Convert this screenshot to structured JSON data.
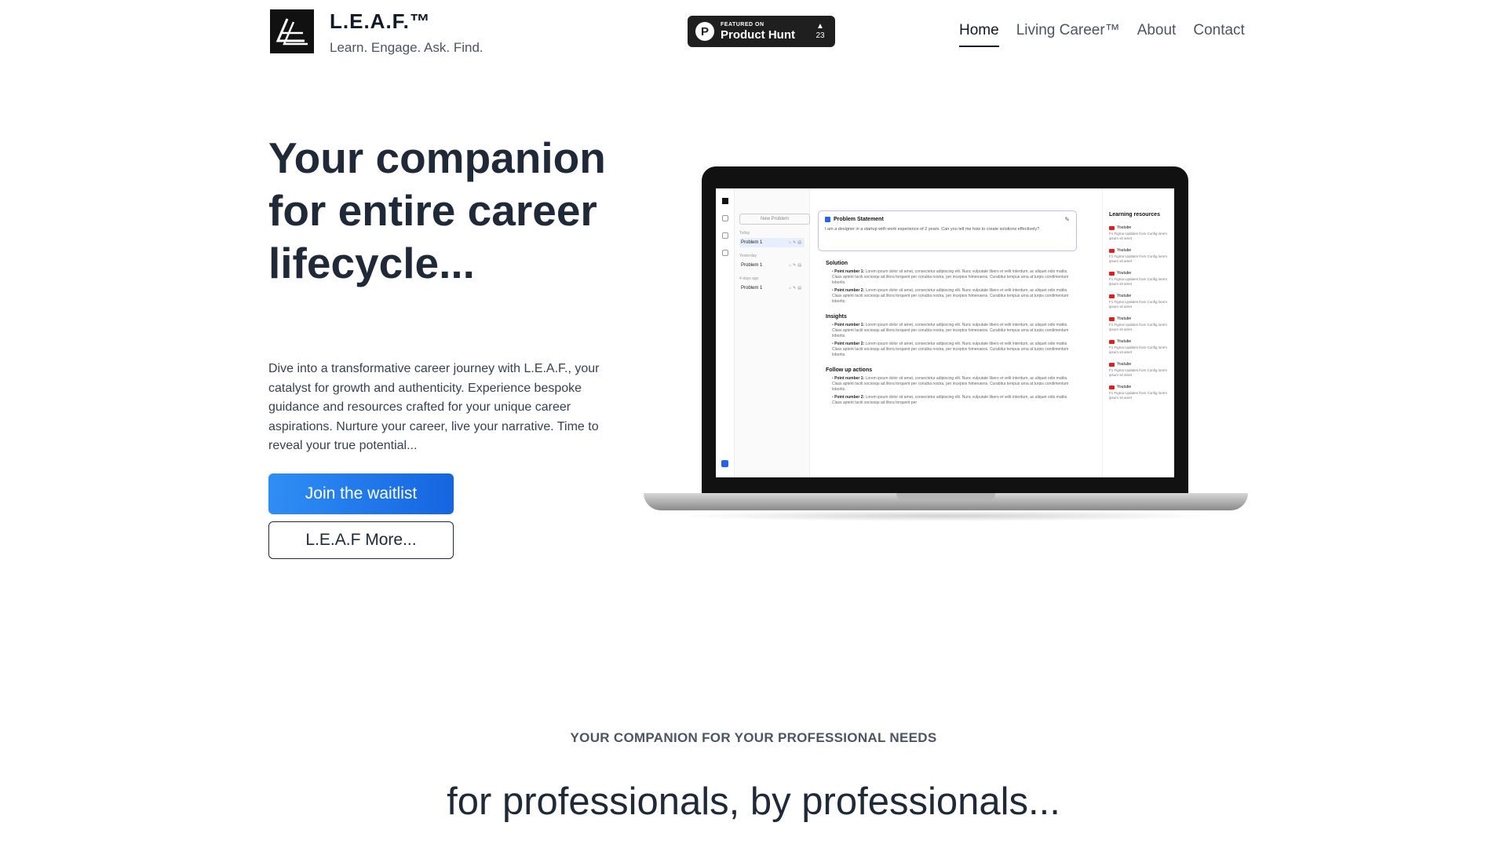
{
  "header": {
    "brand_name": "L.E.A.F.™",
    "brand_tagline": "Learn. Engage. Ask. Find.",
    "product_hunt": {
      "small": "FEATURED ON",
      "big": "Product Hunt",
      "votes": "23",
      "arrow": "▲",
      "logo_letter": "P"
    },
    "nav": [
      {
        "label": "Home",
        "active": true
      },
      {
        "label": "Living Career™",
        "active": false
      },
      {
        "label": "About",
        "active": false
      },
      {
        "label": "Contact",
        "active": false
      }
    ]
  },
  "hero": {
    "title": "Your companion for entire career lifecycle...",
    "description": "Dive into a transformative career journey with L.E.A.F., your catalyst for growth and authenticity. Experience bespoke guidance and resources crafted for your unique career aspirations. Nurture your career, live your narrative. Time to reveal your true potential...",
    "primary_button": "Join the waitlist",
    "secondary_button": "L.E.A.F More..."
  },
  "mockup": {
    "new_problem": "New Problem",
    "groups": [
      {
        "label": "Today",
        "items": [
          "Problem 1"
        ]
      },
      {
        "label": "Yesterday",
        "items": [
          "Problem 1"
        ]
      },
      {
        "label": "4 days ago",
        "items": [
          "Problem 1"
        ]
      }
    ],
    "problem_statement_title": "Problem Statement",
    "problem_statement_text": "I am a designer in a startup with work experience of 2 years. Can you tell me how to create solutions effectively?",
    "sections": [
      {
        "title": "Solution",
        "points": [
          {
            "label": "Point number 1:",
            "text": "Lorem ipsum dolor sit amet, consectetur adipiscing elit. Nunc vulputate libero et velit interdum, ac aliquet odio mattis. Class aptent taciti sociosqu ad litora torquent per conubia nostra, per inceptos himenaeos. Curabitur tempus urna at turpis condimentum lobortis."
          },
          {
            "label": "Point number 2:",
            "text": "Lorem ipsum dolor sit amet, consectetur adipiscing elit. Nunc vulputate libero et velit interdum, ac aliquet odio mattis. Class aptent taciti sociosqu ad litora torquent per conubia nostra, per inceptos himenaeos. Curabitur tempus urna at turpis condimentum lobortis."
          }
        ]
      },
      {
        "title": "Insights",
        "points": [
          {
            "label": "Point number 1:",
            "text": "Lorem ipsum dolor sit amet, consectetur adipiscing elit. Nunc vulputate libero et velit interdum, ac aliquet odio mattis. Class aptent taciti sociosqu ad litora torquent per conubia nostra, per inceptos himenaeos. Curabitur tempus urna at turpis condimentum lobortis."
          },
          {
            "label": "Point number 2:",
            "text": "Lorem ipsum dolor sit amet, consectetur adipiscing elit. Nunc vulputate libero et velit interdum, ac aliquet odio mattis. Class aptent taciti sociosqu ad litora torquent per conubia nostra, per inceptos himenaeos. Curabitur tempus urna at turpis condimentum lobortis."
          }
        ]
      },
      {
        "title": "Follow up actions",
        "points": [
          {
            "label": "Point number 1:",
            "text": "Lorem ipsum dolor sit amet, consectetur adipiscing elit. Nunc vulputate libero et velit interdum, ac aliquet odio mattis. Class aptent taciti sociosqu ad litora torquent per conubia nostra, per inceptos himenaeos. Curabitur tempus urna at turpis condimentum lobortis."
          },
          {
            "label": "Point number 2:",
            "text": "Lorem ipsum dolor sit amet, consectetur adipiscing elit. Nunc vulputate libero et velit interdum, ac aliquet odio mattis. Class aptent taciti sociosqu ad litora torquent per"
          }
        ]
      }
    ],
    "learning_title": "Learning resources",
    "resources": [
      {
        "source": "Youtube",
        "desc": "F1 Figma Updates from Config lorem ipsum sit amet"
      },
      {
        "source": "Youtube",
        "desc": "F1 Figma Updates from Config lorem ipsum sit amet"
      },
      {
        "source": "Youtube",
        "desc": "F1 Figma Updates from Config lorem ipsum sit amet"
      },
      {
        "source": "Youtube",
        "desc": "F1 Figma Updates from Config lorem ipsum sit amet"
      },
      {
        "source": "Youtube",
        "desc": "F1 Figma Updates from Config lorem ipsum sit amet"
      },
      {
        "source": "Youtube",
        "desc": "F1 Figma Updates from Config lorem ipsum sit amet"
      },
      {
        "source": "Youtube",
        "desc": "F1 Figma Updates from Config lorem ipsum sit amet"
      },
      {
        "source": "Youtube",
        "desc": "F1 Figma Updates from Config lorem ipsum sit amet"
      }
    ]
  },
  "section2": {
    "eyebrow": "YOUR COMPANION FOR YOUR PROFESSIONAL NEEDS",
    "tagline": "for professionals, by professionals..."
  },
  "colors": {
    "accent": "#1a73e8",
    "text_dark": "#1f2937",
    "product_hunt_bg": "#1f1f1f"
  }
}
